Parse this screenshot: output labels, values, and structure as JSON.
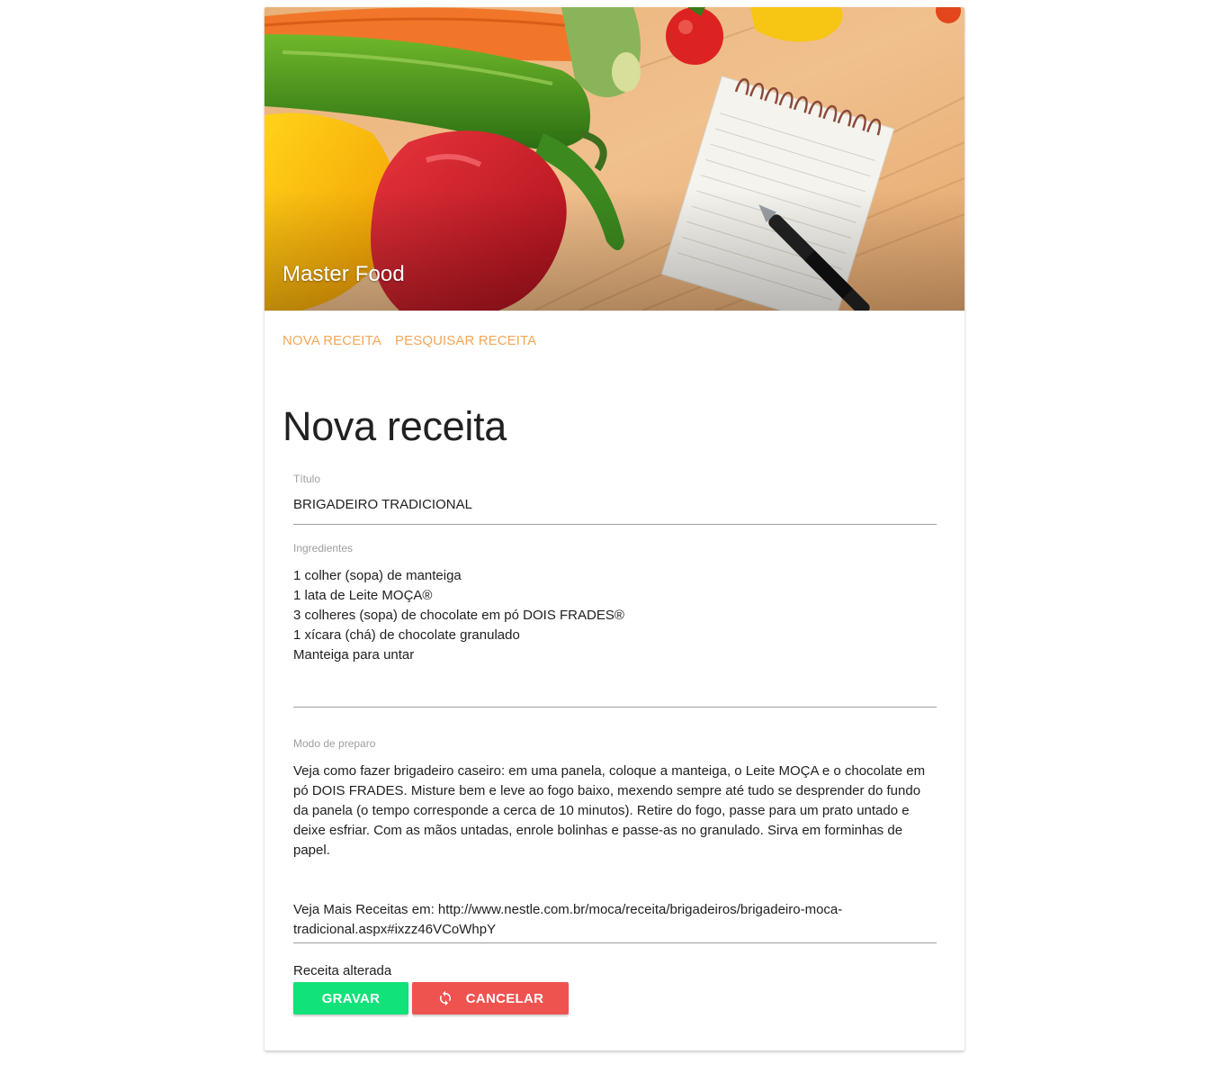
{
  "header": {
    "app_title": "Master Food"
  },
  "nav": {
    "items": [
      {
        "label": "NOVA RECEITA"
      },
      {
        "label": "PESQUISAR RECEITA"
      }
    ]
  },
  "page": {
    "heading": "Nova receita"
  },
  "form": {
    "title_field": {
      "label": "Título",
      "value": "BRIGADEIRO TRADICIONAL"
    },
    "ingredients_field": {
      "label": "Ingredientes",
      "lines": [
        "1 colher (sopa) de manteiga",
        "1 lata de Leite MOÇA®",
        "3 colheres (sopa) de chocolate em pó DOIS FRADES®",
        "1 xícara (chá) de chocolate granulado",
        "Manteiga para untar"
      ]
    },
    "method_field": {
      "label": "Modo de preparo",
      "paragraph": "Veja como fazer brigadeiro caseiro: em uma panela, coloque a manteiga, o Leite MOÇA e o chocolate em pó DOIS FRADES. Misture bem e leve ao fogo baixo, mexendo sempre até tudo se desprender do fundo da panela (o tempo corresponde a cerca de 10 minutos). Retire do fogo, passe para um prato untado e deixe esfriar. Com as mãos untadas, enrole bolinhas e passe-as no granulado. Sirva em forminhas de papel.",
      "source": "Veja Mais Receitas em: http://www.nestle.com.br/moca/receita/brigadeiros/brigadeiro-moca-tradicional.aspx#ixzz46VCoWhpY"
    },
    "status": "Receita alterada",
    "save_label": "GRAVAR",
    "cancel_label": "CANCELAR"
  },
  "colors": {
    "accent": "#f4a658",
    "save": "#12e27a",
    "cancel": "#ef5350"
  },
  "icons": {
    "cancel": "refresh-icon"
  }
}
